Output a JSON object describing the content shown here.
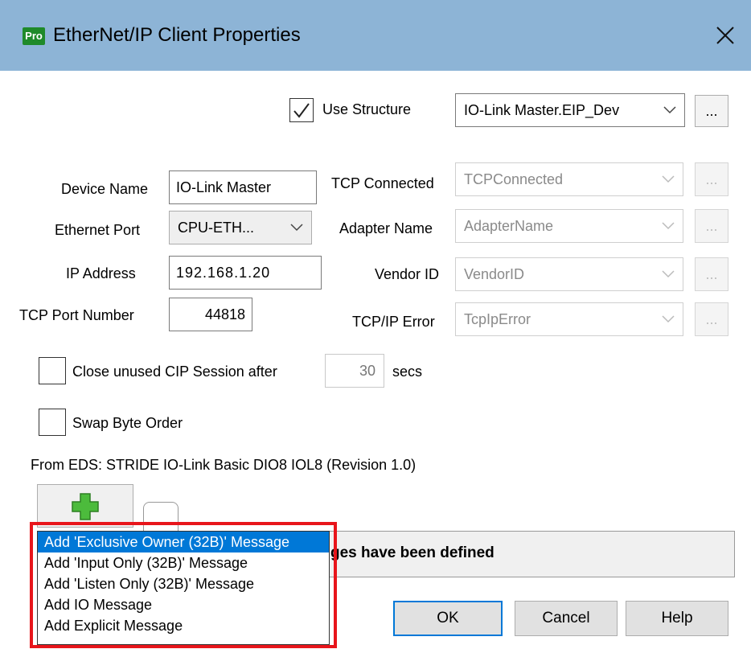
{
  "window": {
    "app_icon_text": "Pro",
    "title": "EtherNet/IP Client Properties",
    "close_icon": "close-icon"
  },
  "structure": {
    "checkbox_label": "Use Structure",
    "checked": true,
    "combo_value": "IO-Link Master.EIP_Dev",
    "browse_label": "..."
  },
  "device": {
    "name_label": "Device Name",
    "name_value": "IO-Link Master",
    "port_label": "Ethernet Port",
    "port_value": "CPU-ETH...",
    "ip_label": "IP Address",
    "ip_value": "192.168.1.20",
    "tcp_port_label": "TCP Port Number",
    "tcp_port_value": "44818"
  },
  "status": {
    "tcp_connected_label": "TCP Connected",
    "tcp_connected_value": "TCPConnected",
    "adapter_label": "Adapter Name",
    "adapter_value": "AdapterName",
    "vendor_label": "Vendor ID",
    "vendor_value": "VendorID",
    "error_label": "TCP/IP Error",
    "error_value": "TcpIpError",
    "browse_label": "..."
  },
  "options": {
    "close_session_label": "Close unused CIP Session after",
    "close_session_value": "30",
    "secs_label": "secs",
    "swap_label": "Swap Byte Order"
  },
  "eds_text": "From EDS: STRIDE IO-Link Basic DIO8 IOL8 (Revision 1.0)",
  "message_panel_text": "ges have been defined",
  "menu": {
    "items": [
      "Add 'Exclusive Owner (32B)' Message",
      "Add 'Input Only (32B)' Message",
      "Add 'Listen Only (32B)' Message",
      "Add IO Message",
      "Add Explicit Message"
    ],
    "selected_index": 0
  },
  "buttons": {
    "ok": "OK",
    "cancel": "Cancel",
    "help": "Help"
  },
  "colors": {
    "titlebar": "#8db4d6",
    "selection": "#0078d7",
    "highlight": "#e8151b",
    "add_icon": "#4cbb3c"
  }
}
